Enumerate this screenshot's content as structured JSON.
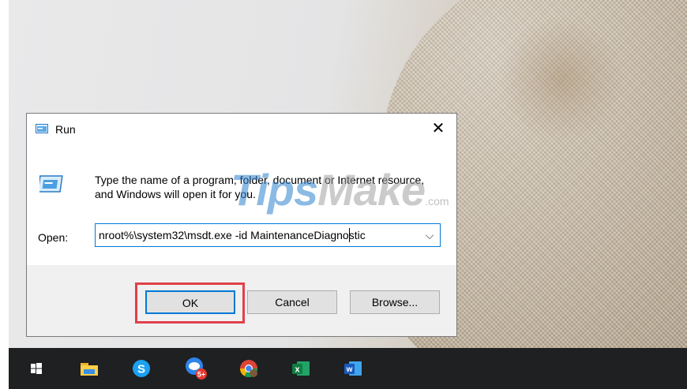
{
  "dialog": {
    "title": "Run",
    "close_glyph": "✕",
    "description": "Type the name of a program, folder, document or Internet resource, and Windows will open it for you.",
    "open_label": "Open:",
    "open_value": "nroot%\\system32\\msdt.exe -id MaintenanceDiagnostic",
    "dropdown_glyph": "⌵",
    "buttons": {
      "ok": "OK",
      "cancel": "Cancel",
      "browse": "Browse..."
    }
  },
  "watermark": {
    "main_blue": "Tips",
    "main_gray": "Make",
    "suffix": ".com"
  },
  "taskbar": {
    "items": [
      {
        "icon": "windows-start-icon"
      },
      {
        "icon": "file-explorer-icon"
      },
      {
        "icon": "skype-icon",
        "glyph": "S"
      },
      {
        "icon": "zalo-icon",
        "badge": "5+"
      },
      {
        "icon": "chrome-icon"
      },
      {
        "icon": "excel-icon",
        "glyph": "x"
      },
      {
        "icon": "word-icon",
        "glyph": "w"
      }
    ]
  },
  "colors": {
    "accent": "#0078d7",
    "highlight": "#e0404a",
    "taskbar": "#1f2022"
  }
}
